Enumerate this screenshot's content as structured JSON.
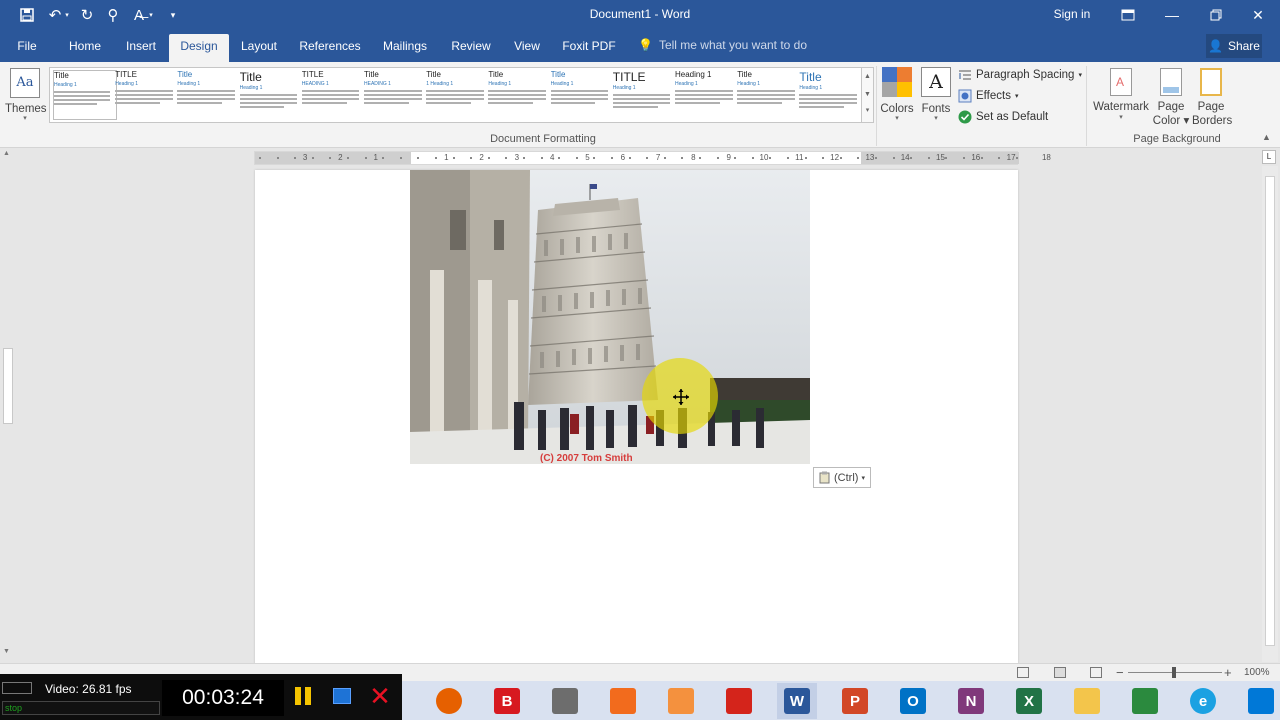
{
  "window": {
    "title": "Document1 - Word",
    "sign_in": "Sign in"
  },
  "tabs": [
    {
      "label": "File"
    },
    {
      "label": "Home"
    },
    {
      "label": "Insert"
    },
    {
      "label": "Design"
    },
    {
      "label": "Layout"
    },
    {
      "label": "References"
    },
    {
      "label": "Mailings"
    },
    {
      "label": "Review"
    },
    {
      "label": "View"
    },
    {
      "label": "Foxit PDF"
    }
  ],
  "active_tab": "Design",
  "tell_me": "Tell me what you want to do",
  "share_label": "Share",
  "ribbon": {
    "themes_label": "Themes",
    "style_set_titles": [
      "Title",
      "TITLE",
      "Title",
      "Title",
      "TITLE",
      "Title",
      "Title",
      "Title",
      "Title",
      "TITLE",
      "Heading 1",
      "Title",
      "Title"
    ],
    "style_set_subtitles": [
      "Heading 1",
      "Heading 1",
      "Heading 1",
      "Heading 1",
      "HEADING 1",
      "HEADING 1",
      "1 Heading 1",
      "Heading 1",
      "Heading 1",
      "Heading 1",
      "Heading 1",
      "Heading 1",
      "Heading 1"
    ],
    "document_formatting_label": "Document Formatting",
    "colors_label": "Colors",
    "fonts_label": "Fonts",
    "paragraph_spacing_label": "Paragraph Spacing",
    "effects_label": "Effects",
    "set_as_default_label": "Set as Default",
    "watermark_label": "Watermark",
    "page_color_label": [
      "Page",
      "Color"
    ],
    "page_borders_label": [
      "Page",
      "Borders"
    ],
    "page_background_label": "Page Background",
    "theme_colors": [
      "#4472c4",
      "#ed7d31",
      "#a5a5a5",
      "#ffc000"
    ]
  },
  "ruler_numbers": [
    "3",
    "2",
    "1",
    "1",
    "2",
    "3",
    "4",
    "5",
    "6",
    "7",
    "8",
    "9",
    "10",
    "11",
    "12",
    "13",
    "14",
    "15",
    "16",
    "17",
    "18"
  ],
  "document": {
    "photo_caption": "(C) 2007 Tom Smith",
    "paste_options_label": "(Ctrl)"
  },
  "statusbar": {
    "zoom_percent": "100%",
    "zoom_minus": "−",
    "zoom_plus": "+"
  },
  "recorder": {
    "fps": "Video: 26.81 fps",
    "elapsed": "00:03:24",
    "stop_label": "stop"
  },
  "taskbar_apps": [
    {
      "name": "Firefox",
      "letter": "",
      "color": "#e66000"
    },
    {
      "name": "B",
      "letter": "B",
      "color": "#d71920"
    },
    {
      "name": "Temple",
      "letter": "",
      "color": "#6d6d6d"
    },
    {
      "name": "Snagit",
      "letter": "",
      "color": "#f26b1d"
    },
    {
      "name": "Camera",
      "letter": "",
      "color": "#f4913e"
    },
    {
      "name": "Acrobat",
      "letter": "",
      "color": "#d4241b"
    },
    {
      "name": "Word",
      "letter": "W",
      "color": "#2b579a"
    },
    {
      "name": "PowerPoint",
      "letter": "P",
      "color": "#d24726"
    },
    {
      "name": "Outlook",
      "letter": "O",
      "color": "#0072c6"
    },
    {
      "name": "OneNote",
      "letter": "N",
      "color": "#80397b"
    },
    {
      "name": "Excel",
      "letter": "X",
      "color": "#217346"
    },
    {
      "name": "File Explorer",
      "letter": "",
      "color": "#f3c54b"
    },
    {
      "name": "Store",
      "letter": "",
      "color": "#2b8a3e"
    },
    {
      "name": "Internet Explorer",
      "letter": "e",
      "color": "#1ba1e2"
    },
    {
      "name": "Windows",
      "letter": "",
      "color": "#0078d7"
    }
  ]
}
